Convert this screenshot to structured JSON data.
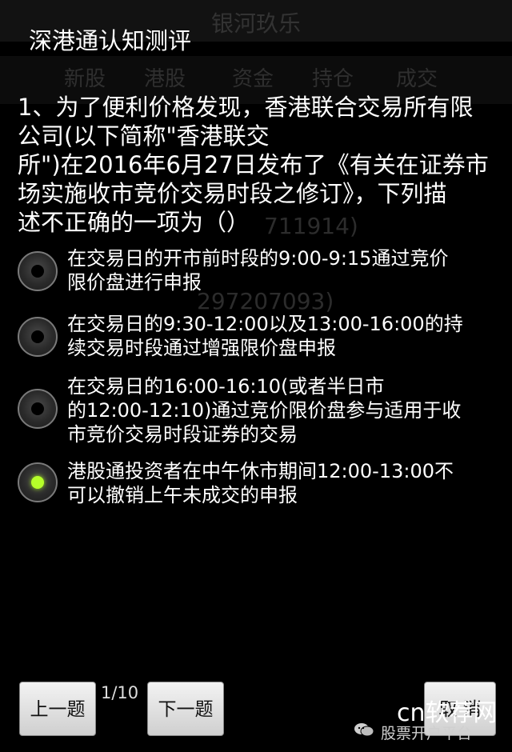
{
  "background_app": {
    "title": "银河玖乐",
    "tabs": [
      "新股",
      "港股",
      "资金",
      "持仓",
      "成交"
    ],
    "rows": [
      "711914)",
      "297207093)"
    ]
  },
  "dialog": {
    "title": "深港通认知测评",
    "question_lines": [
      "1、为了便利价格发现，香港联合交易所有限",
      "公司(以下简称\"香港联交",
      "所\")在2016年6月27日发布了《有关在证券市",
      "场实施收市竞价交易时段之修订》，下列描",
      "述不正确的一项为（）"
    ],
    "options": [
      {
        "lines": [
          "在交易日的开市前时段的9:00-9:15通过竞价",
          "限价盘进行申报"
        ],
        "selected": false
      },
      {
        "lines": [
          "在交易日的9:30-12:00以及13:00-16:00的持",
          "续交易时段通过增强限价盘申报"
        ],
        "selected": false
      },
      {
        "lines": [
          "在交易日的16:00-16:10(或者半日市",
          "的12:00-12:10)通过竞价限价盘参与适用于收",
          "市竞价交易时段证券的交易"
        ],
        "selected": false
      },
      {
        "lines": [
          "港股通投资者在中午休市期间12:00-13:00不",
          "可以撤销上午未成交的申报"
        ],
        "selected": true
      }
    ],
    "buttons": {
      "prev": "上一题",
      "next": "下一题",
      "cancel": "取 消"
    },
    "counter": "1/10"
  },
  "watermark": {
    "main": "cn软荐网",
    "sub": "股票开户平台"
  },
  "colors": {
    "selected_radio": "#b6ff2a",
    "button_bg": "#e6e6e6",
    "background": "#000000"
  }
}
